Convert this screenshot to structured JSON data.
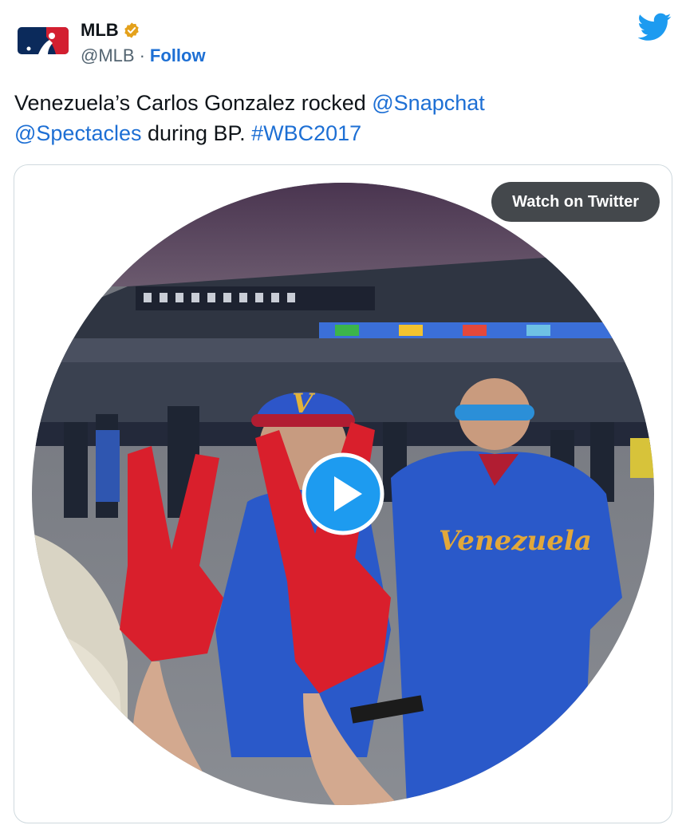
{
  "author": {
    "name": "MLB",
    "handle": "@MLB",
    "separator": "·",
    "follow_label": "Follow",
    "logo_icon": "mlb-logo-icon",
    "verified_icon": "verified-badge-icon"
  },
  "platform_icon": "twitter-bird-icon",
  "tweet": {
    "text_part1": "Venezuela’s Carlos Gonzalez rocked ",
    "mention1": "@Snapchat",
    "mention2": "@Spectacles",
    "text_part2": " during BP. ",
    "hashtag": "#WBC2017"
  },
  "media": {
    "watch_label": "Watch on Twitter",
    "play_icon": "play-icon",
    "jersey_text": "Venezuela",
    "cap_letter": "V"
  },
  "colors": {
    "link": "#1d6fd4",
    "twitter_blue": "#1d9bf0",
    "verified_gold": "#e4a11b",
    "mlb_navy": "#0b2a5b",
    "mlb_red": "#d31f30"
  }
}
